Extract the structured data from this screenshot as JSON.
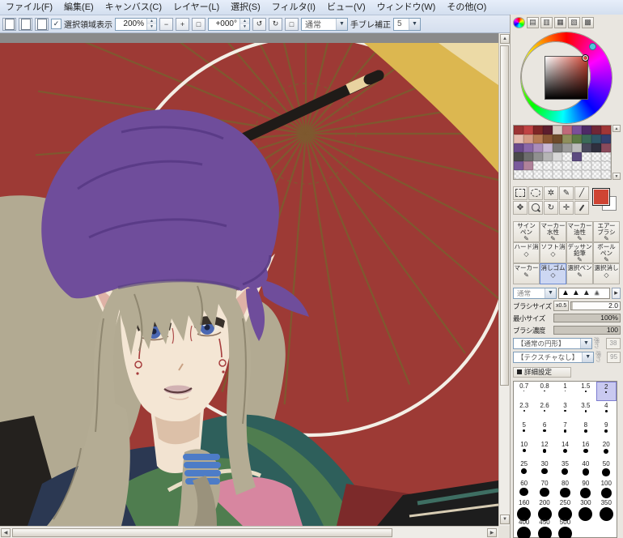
{
  "menu": {
    "items": [
      "ファイル(F)",
      "編集(E)",
      "キャンバス(C)",
      "レイヤー(L)",
      "選択(S)",
      "フィルタ(I)",
      "ビュー(V)",
      "ウィンドウ(W)",
      "その他(O)"
    ]
  },
  "toolbar": {
    "select_area_label": "選択領域表示",
    "zoom": {
      "value": "200%",
      "out": "−",
      "in": "+",
      "reset": "□"
    },
    "rotation": {
      "value": "+000°",
      "ccw": "↺",
      "cw": "↻",
      "reset": "□"
    },
    "blend": "通常",
    "stabilizer_label": "手ブレ補正",
    "stabilizer_value": "5"
  },
  "color_panel": {
    "selected_color": "#cf4433",
    "accent_red": "#9d3a35",
    "swatches": [
      "#9c3434",
      "#c04343",
      "#7e2626",
      "#5c1d2e",
      "#d9c9c2",
      "#c06a7a",
      "#7a4f9a",
      "#4e2a66",
      "#702636",
      "#a03636",
      "#e6bdb0",
      "#d39a84",
      "#b57a55",
      "#8a5634",
      "#6e4a2a",
      "#8f8f5c",
      "#5d7a45",
      "#3c6a58",
      "#2f5668",
      "#33406f",
      "#6a4a8c",
      "#8a68a8",
      "#a98cba",
      "#c9b8d6",
      "#7a7a7a",
      "#9a9a9a",
      "#bcbcbc",
      "#49495c",
      "#2f2f3e",
      "#8a4a5c",
      "#4a4a4a",
      "#6d6d6d",
      "#909090",
      "#b5b5b5",
      "#d8d8d8",
      null,
      "#5c4a80",
      null,
      null,
      null,
      "#7a5a9c",
      "#b0829a",
      null,
      null,
      null,
      null,
      null,
      null,
      null,
      null,
      null,
      null,
      null,
      null,
      null,
      null,
      null,
      null,
      null,
      null
    ]
  },
  "tools": {
    "selected_index": 9,
    "grid": [
      {
        "id": "sign-pen",
        "lines": [
          "サイン",
          "ペン"
        ],
        "icon": "✎"
      },
      {
        "id": "marker-water",
        "lines": [
          "マーカー",
          "水性"
        ],
        "icon": "✎"
      },
      {
        "id": "marker-oil",
        "lines": [
          "マーカー",
          "油性"
        ],
        "icon": "✎"
      },
      {
        "id": "airbrush",
        "lines": [
          "エアー",
          "ブラシ"
        ],
        "icon": "✎"
      },
      {
        "id": "hard-eraser",
        "lines": [
          "ハード消"
        ],
        "icon": "◇"
      },
      {
        "id": "soft-eraser",
        "lines": [
          "ソフト消"
        ],
        "icon": "◇"
      },
      {
        "id": "sketch-pencil",
        "lines": [
          "デッサン",
          "鉛筆"
        ],
        "icon": "✎"
      },
      {
        "id": "ballpoint-pen",
        "lines": [
          "ボール",
          "ペン"
        ],
        "icon": "✎"
      },
      {
        "id": "marker",
        "lines": [
          "マーカー"
        ],
        "icon": "✎"
      },
      {
        "id": "eraser",
        "lines": [
          "消しゴム"
        ],
        "icon": "◇"
      },
      {
        "id": "select-pen",
        "lines": [
          "選択ペン"
        ],
        "icon": "✎"
      },
      {
        "id": "select-eraser",
        "lines": [
          "選択消し"
        ],
        "icon": "◇"
      }
    ]
  },
  "brush": {
    "blend_mode": "通常",
    "size_label": "ブラシサイズ",
    "size_unit": "x0.5",
    "size_value": "2.0",
    "min_size_label": "最小サイズ",
    "min_size_value": "100%",
    "density_label": "ブラシ濃度",
    "density_value": "100",
    "shape_name": "【通常の円形】",
    "shape_strength_label": "強さ",
    "shape_strength": "38",
    "texture_name": "【テクスチャなし】",
    "texture_strength_label": "強さ",
    "texture_strength": "95",
    "advanced_label": "詳細設定"
  },
  "sizes": {
    "selected": "2",
    "values": [
      "0.7",
      "0.8",
      "1",
      "1.5",
      "2",
      "2.3",
      "2.6",
      "3",
      "3.5",
      "4",
      "5",
      "6",
      "7",
      "8",
      "9",
      "10",
      "12",
      "14",
      "16",
      "20",
      "25",
      "30",
      "35",
      "40",
      "50",
      "60",
      "70",
      "80",
      "90",
      "100",
      "160",
      "200",
      "250",
      "300",
      "350",
      "400",
      "450",
      "500"
    ]
  }
}
